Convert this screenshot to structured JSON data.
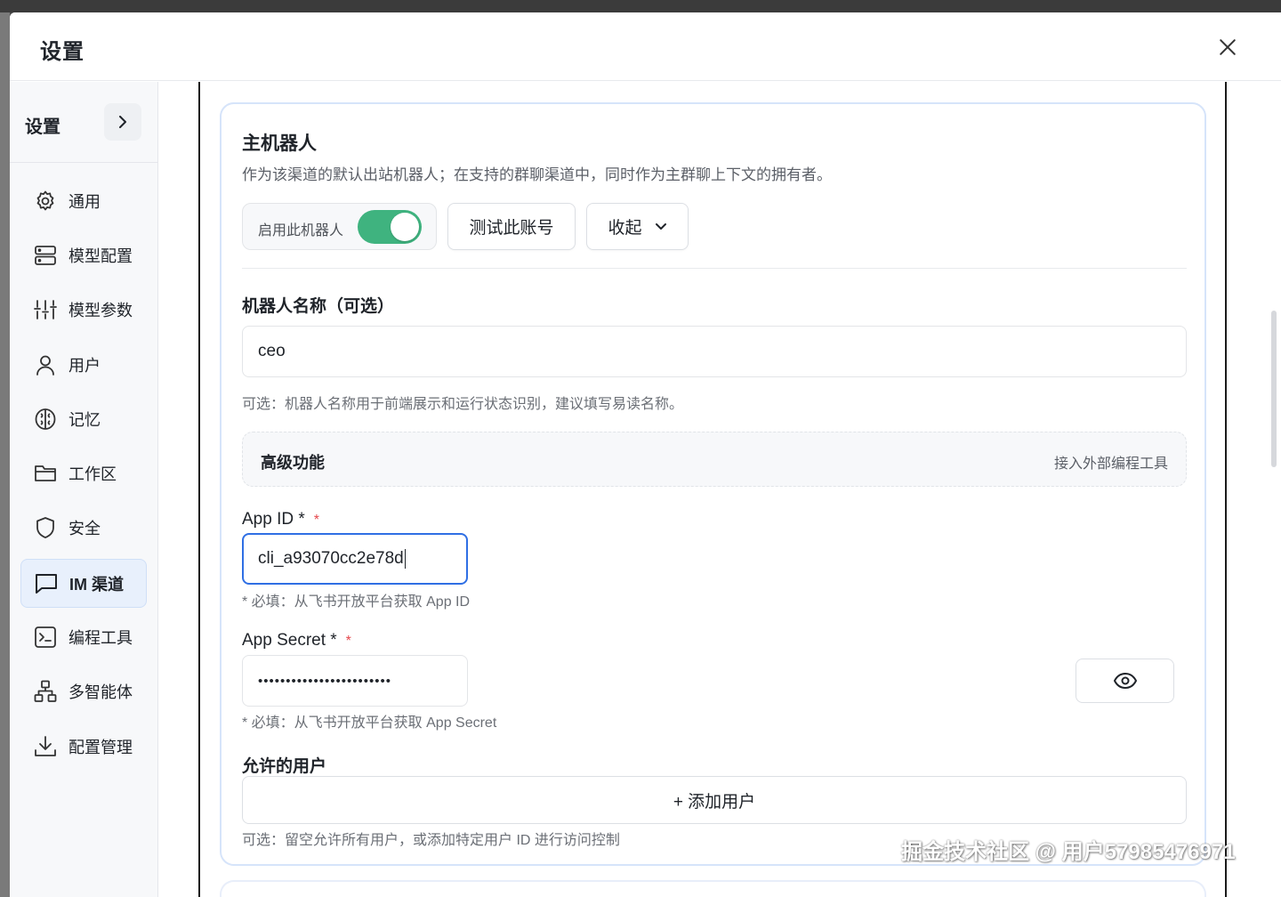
{
  "window": {
    "title": "设置"
  },
  "sidebar": {
    "header": "设置",
    "items": [
      {
        "label": "通用",
        "icon": "gear-icon"
      },
      {
        "label": "模型配置",
        "icon": "server-icon"
      },
      {
        "label": "模型参数",
        "icon": "sliders-icon"
      },
      {
        "label": "用户",
        "icon": "user-icon"
      },
      {
        "label": "记忆",
        "icon": "brain-icon"
      },
      {
        "label": "工作区",
        "icon": "folder-icon"
      },
      {
        "label": "安全",
        "icon": "shield-icon"
      },
      {
        "label": "IM 渠道",
        "icon": "chat-icon",
        "active": true
      },
      {
        "label": "编程工具",
        "icon": "terminal-icon"
      },
      {
        "label": "多智能体",
        "icon": "network-icon"
      },
      {
        "label": "配置管理",
        "icon": "download-icon"
      }
    ]
  },
  "bot": {
    "title": "主机器人",
    "description": "作为该渠道的默认出站机器人；在支持的群聊渠道中，同时作为主群聊上下文的拥有者。",
    "enable_label": "启用此机器人",
    "enabled": true,
    "test_button": "测试此账号",
    "collapse_button": "收起",
    "name": {
      "label": "机器人名称（可选）",
      "value": "ceo",
      "hint": "可选：机器人名称用于前端展示和运行状态识别，建议填写易读名称。"
    },
    "advanced": {
      "title": "高级功能",
      "link": "接入外部编程工具"
    },
    "app_id": {
      "label": "App ID *",
      "required_mark": "*",
      "value": "cli_a93070cc2e78d",
      "hint": "* 必填：从飞书开放平台获取 App ID"
    },
    "app_secret": {
      "label": "App Secret *",
      "required_mark": "*",
      "value": "••••••••••••••••••••••••",
      "hint": "* 必填：从飞书开放平台获取 App Secret"
    },
    "allowed_users": {
      "label": "允许的用户",
      "add_button": "+ 添加用户",
      "hint": "可选：留空允许所有用户，或添加特定用户 ID 进行访问控制"
    }
  },
  "watermark": "掘金技术社区 @ 用户57985476971",
  "colors": {
    "accent": "#2f6fe4",
    "toggle_on": "#3fb37f",
    "active_bg": "#e8f0fc",
    "required": "#e5484d"
  }
}
